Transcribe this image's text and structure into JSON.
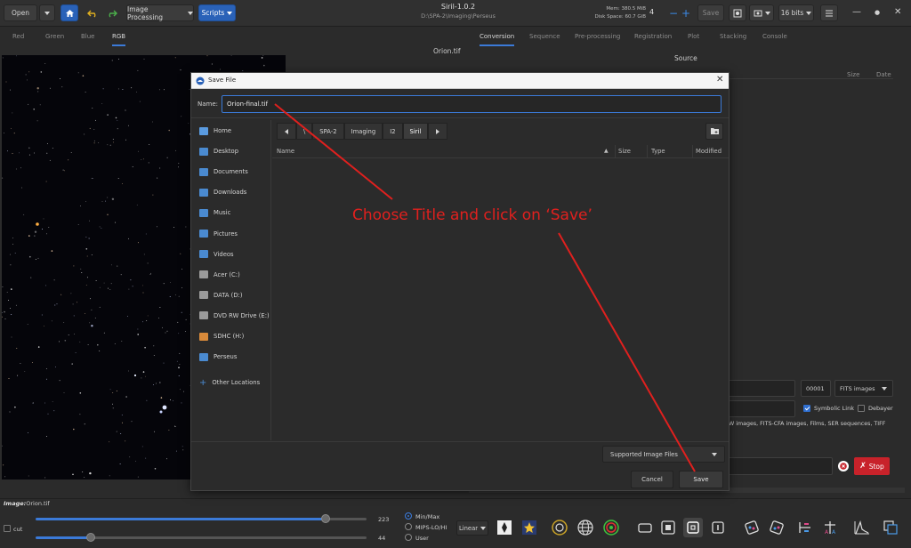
{
  "header": {
    "open_label": "Open",
    "image_processing_label": "Image Processing",
    "scripts_label": "Scripts",
    "app_title": "Siril-1.0.2",
    "app_path": "D:\\SPA-2\\Imaging\\Perseus",
    "mem_label": "Mem: 380.5 MiB",
    "disk_label": "Disk Space: 60.7 GiB",
    "thread_count": "4",
    "save_label": "Save",
    "bit_depth": "16 bits",
    "accent_color": "#2a62b8"
  },
  "channel_tabs": [
    "Red",
    "Green",
    "Blue",
    "RGB"
  ],
  "image_title": "Orion.tif",
  "right_tabs": [
    "Conversion",
    "Sequence",
    "Pre-processing",
    "Registration",
    "Plot",
    "Stacking",
    "Console"
  ],
  "conversion": {
    "source_label": "Source",
    "size_col": "Size",
    "date_col": "Date",
    "seq_number": "00001",
    "format_select": "FITS images",
    "symbolic_link_label": "Symbolic Link",
    "debayer_label": "Debayer",
    "formats_text": "W images, FITS-CFA images, Films, SER sequences, TIFF",
    "stop_label": "Stop",
    "progress": 0
  },
  "bottom": {
    "image_label": "Image:",
    "image_name": "Orion.tif",
    "cut_label": "cut",
    "high_value": "223",
    "low_value": "44",
    "mode_minmax": "Min/Max",
    "mode_mips": "MIPS-LO/HI",
    "mode_user": "User",
    "scale_select": "Linear"
  },
  "dialog": {
    "title": "Save File",
    "name_label": "Name:",
    "name_value": "Orion-final.tif",
    "places": [
      "Home",
      "Desktop",
      "Documents",
      "Downloads",
      "Music",
      "Pictures",
      "Videos",
      "Acer (C:)",
      "DATA (D:)",
      "DVD RW Drive (E:)",
      "SDHC (H:)",
      "Perseus"
    ],
    "other_locations": "Other Locations",
    "path_crumbs": [
      "\\",
      "SPA-2",
      "Imaging",
      "I2",
      "Siril"
    ],
    "columns": {
      "name": "Name",
      "size": "Size",
      "type": "Type",
      "modified": "Modified"
    },
    "filter_label": "Supported Image Files",
    "cancel_label": "Cancel",
    "save_label": "Save"
  },
  "annotation": {
    "text": "Choose Title and click on ‘Save’",
    "color": "#e0201e"
  }
}
